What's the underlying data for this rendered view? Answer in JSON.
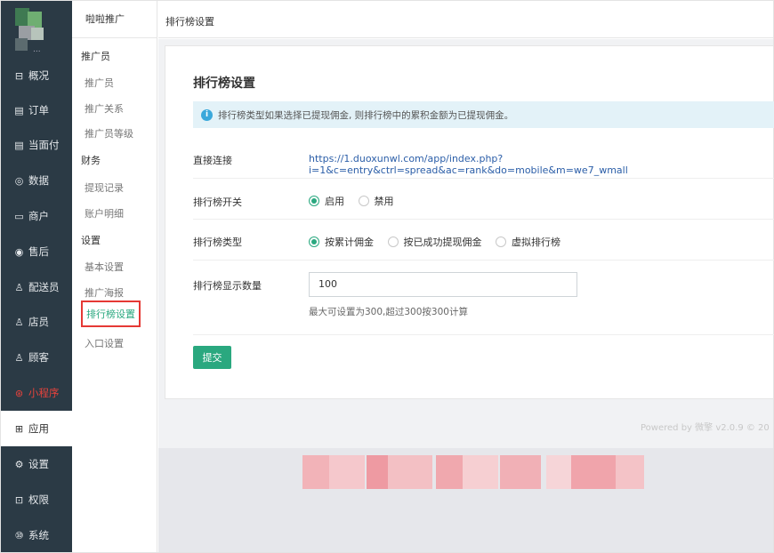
{
  "sidebar": {
    "items": [
      {
        "label": "概况",
        "icon": "overview-icon",
        "glyph": "⊟"
      },
      {
        "label": "订单",
        "icon": "order-icon",
        "glyph": "▤"
      },
      {
        "label": "当面付",
        "icon": "face-pay-icon",
        "glyph": "▤"
      },
      {
        "label": "数据",
        "icon": "data-icon",
        "glyph": "◎"
      },
      {
        "label": "商户",
        "icon": "merchant-icon",
        "glyph": "▭"
      },
      {
        "label": "售后",
        "icon": "after-sale-icon",
        "glyph": "◉"
      },
      {
        "label": "配送员",
        "icon": "courier-icon",
        "glyph": "♙"
      },
      {
        "label": "店员",
        "icon": "clerk-icon",
        "glyph": "♙"
      },
      {
        "label": "顾客",
        "icon": "customer-icon",
        "glyph": "♙"
      },
      {
        "label": "小程序",
        "icon": "miniprogram-icon",
        "glyph": "⊛"
      },
      {
        "label": "应用",
        "icon": "apps-icon",
        "glyph": "⊞"
      },
      {
        "label": "设置",
        "icon": "settings-icon",
        "glyph": "⚙"
      },
      {
        "label": "权限",
        "icon": "lock-icon",
        "glyph": "⊡"
      },
      {
        "label": "系统",
        "icon": "system-icon",
        "glyph": "⑩"
      }
    ],
    "avatar_dots": "..."
  },
  "submenu": {
    "title": "啦啦推广",
    "groups": {
      "promoter": "推广员",
      "finance": "财务",
      "settings": "设置"
    },
    "links": {
      "promoter": "推广员",
      "relation": "推广关系",
      "level": "推广员等级",
      "withdraw": "提现记录",
      "account": "账户明细",
      "basic": "基本设置",
      "poster": "推广海报",
      "rank": "排行榜设置",
      "entry": "入口设置"
    }
  },
  "topbar": {
    "title": "排行榜设置"
  },
  "panel": {
    "title": "排行榜设置",
    "alert": "排行榜类型如果选择已提现佣金, 则排行榜中的累积金额为已提现佣金。",
    "direct_link": {
      "label": "直接连接",
      "url": "https://1.duoxunwl.com/app/index.php?i=1&c=entry&ctrl=spread&ac=rank&do=mobile&m=we7_wmall"
    },
    "switch": {
      "label": "排行榜开关",
      "options": [
        "启用",
        "禁用"
      ],
      "selected": "启用"
    },
    "type": {
      "label": "排行榜类型",
      "options": [
        "按累计佣金",
        "按已成功提现佣金",
        "虚拟排行榜"
      ],
      "selected": "按累计佣金"
    },
    "count": {
      "label": "排行榜显示数量",
      "value": "100",
      "hint": "最大可设置为300,超过300按300计算"
    },
    "submit": "提交"
  },
  "footer": {
    "powered": "Powered by 微擎 v2.0.9 © 20"
  },
  "colors": {
    "sidebar_bg": "#2b3a45",
    "accent": "#2aa87f",
    "highlight": "#e8433c",
    "link": "#2b5ea8",
    "alert_bg": "#e3f2f8"
  }
}
